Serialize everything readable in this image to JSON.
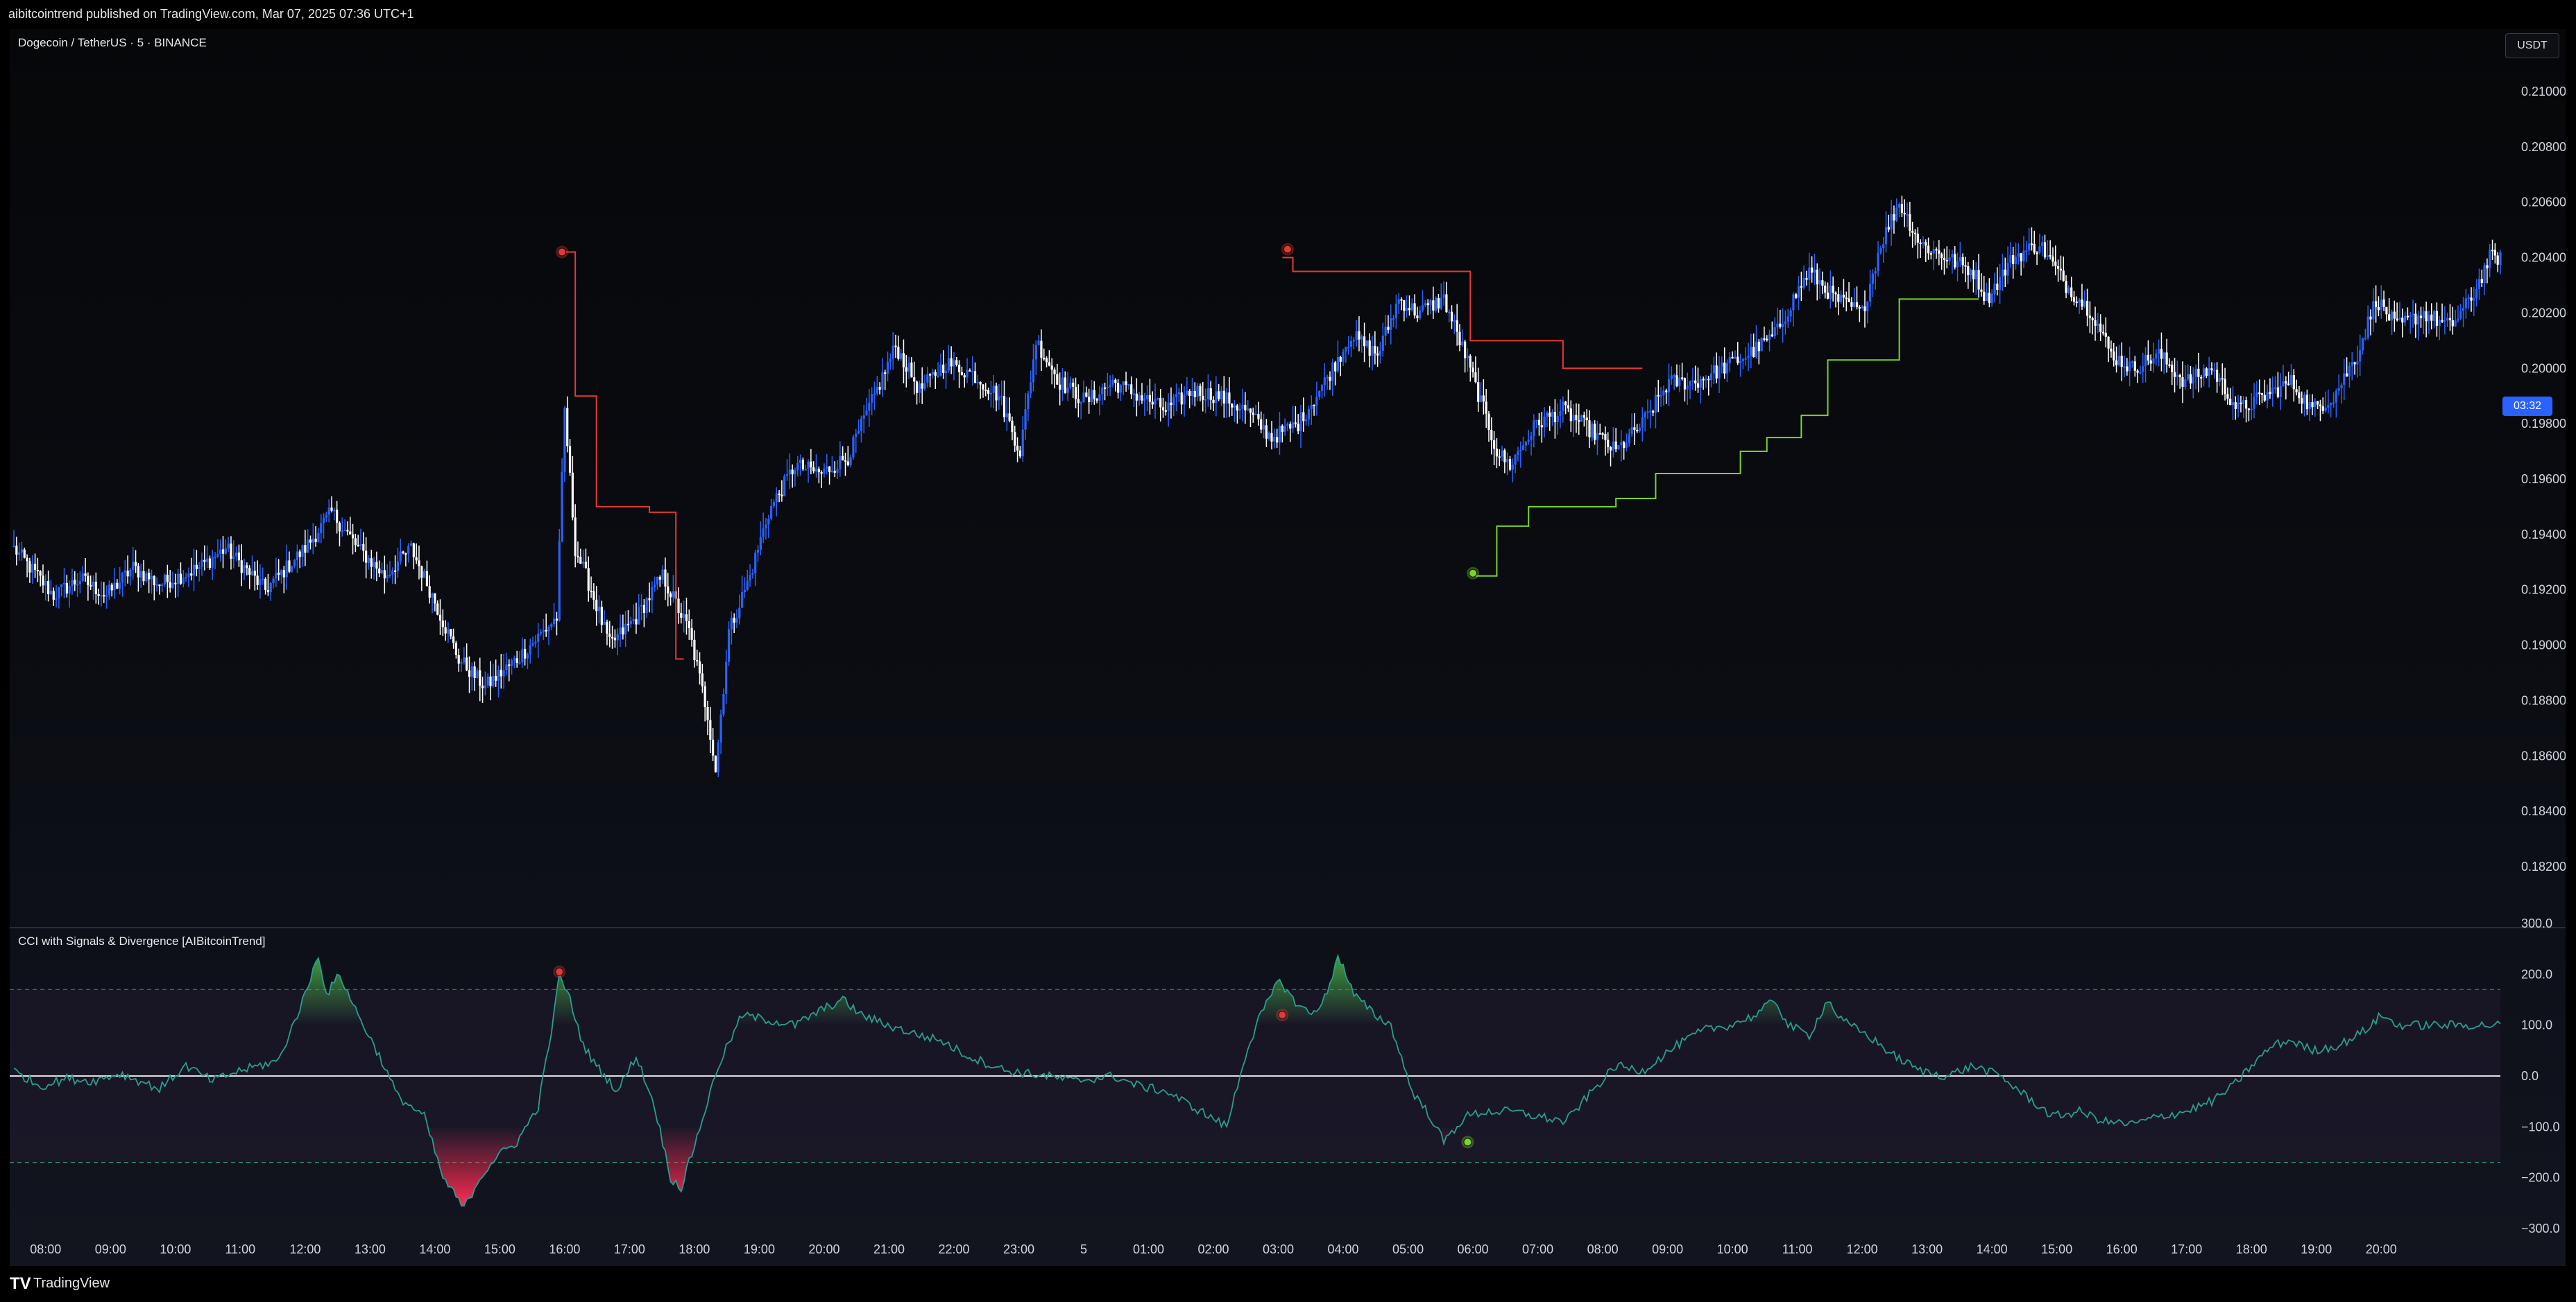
{
  "header": {
    "published_text": "aibitcointrend published on TradingView.com, Mar 07, 2025 07:36 UTC+1"
  },
  "chart": {
    "symbol_title": "Dogecoin / TetherUS · 5 · BINANCE",
    "currency_badge": "USDT",
    "price_countdown": "03:32"
  },
  "indicator": {
    "title": "CCI with Signals & Divergence [AIBitcoinTrend]"
  },
  "footer": {
    "brand": "TradingView",
    "logo": "TV"
  },
  "colors": {
    "up_candle": "#2962ff",
    "down_candle": "#ffffff",
    "bear_trail": "#e53935",
    "bull_trail": "#7cd322",
    "cci_line": "#2a9d8f",
    "cci_pos_fill": "#43a047",
    "cci_neg_fill": "#ff2d55"
  },
  "chart_data": [
    {
      "type": "candlestick",
      "title": "Dogecoin / TetherUS · 5 · BINANCE",
      "y_ticks": [
        "0.21000",
        "0.20800",
        "0.20600",
        "0.20400",
        "0.20200",
        "0.20000",
        "0.19800",
        "0.19600",
        "0.19400",
        "0.19200",
        "0.19000",
        "0.18800",
        "0.18600",
        "0.18400",
        "0.18200"
      ],
      "ylim": [
        0.1812,
        0.211
      ],
      "price_anchors": [
        [
          0,
          0.1935
        ],
        [
          15,
          0.1918
        ],
        [
          25,
          0.1924
        ],
        [
          35,
          0.1918
        ],
        [
          45,
          0.1928
        ],
        [
          55,
          0.1922
        ],
        [
          70,
          0.1928
        ],
        [
          80,
          0.1935
        ],
        [
          95,
          0.192
        ],
        [
          110,
          0.1935
        ],
        [
          120,
          0.1948
        ],
        [
          130,
          0.1935
        ],
        [
          140,
          0.1925
        ],
        [
          150,
          0.1935
        ],
        [
          158,
          0.1918
        ],
        [
          168,
          0.1895
        ],
        [
          178,
          0.1885
        ],
        [
          190,
          0.1895
        ],
        [
          200,
          0.1905
        ],
        [
          205,
          0.191
        ],
        [
          208,
          0.1985
        ],
        [
          212,
          0.1935
        ],
        [
          218,
          0.192
        ],
        [
          225,
          0.19
        ],
        [
          235,
          0.191
        ],
        [
          245,
          0.1925
        ],
        [
          255,
          0.1905
        ],
        [
          262,
          0.1875
        ],
        [
          265,
          0.1855
        ],
        [
          270,
          0.1905
        ],
        [
          278,
          0.1925
        ],
        [
          285,
          0.1948
        ],
        [
          295,
          0.1965
        ],
        [
          305,
          0.1962
        ],
        [
          315,
          0.1968
        ],
        [
          325,
          0.199
        ],
        [
          333,
          0.2008
        ],
        [
          342,
          0.1992
        ],
        [
          352,
          0.2002
        ],
        [
          362,
          0.1998
        ],
        [
          372,
          0.199
        ],
        [
          380,
          0.197
        ],
        [
          386,
          0.201
        ],
        [
          395,
          0.1995
        ],
        [
          405,
          0.1988
        ],
        [
          415,
          0.1995
        ],
        [
          425,
          0.199
        ],
        [
          435,
          0.1985
        ],
        [
          445,
          0.1992
        ],
        [
          455,
          0.199
        ],
        [
          465,
          0.1985
        ],
        [
          475,
          0.1975
        ],
        [
          485,
          0.198
        ],
        [
          495,
          0.1995
        ],
        [
          505,
          0.2012
        ],
        [
          515,
          0.2005
        ],
        [
          523,
          0.2025
        ],
        [
          530,
          0.202
        ],
        [
          540,
          0.2025
        ],
        [
          548,
          0.2005
        ],
        [
          555,
          0.1985
        ],
        [
          560,
          0.197
        ],
        [
          565,
          0.1965
        ],
        [
          575,
          0.198
        ],
        [
          585,
          0.1985
        ],
        [
          595,
          0.1978
        ],
        [
          605,
          0.197
        ],
        [
          615,
          0.198
        ],
        [
          625,
          0.1995
        ],
        [
          635,
          0.1995
        ],
        [
          645,
          0.2
        ],
        [
          655,
          0.2005
        ],
        [
          665,
          0.2012
        ],
        [
          672,
          0.2025
        ],
        [
          678,
          0.2035
        ],
        [
          688,
          0.2025
        ],
        [
          698,
          0.202
        ],
        [
          705,
          0.2045
        ],
        [
          712,
          0.206
        ],
        [
          720,
          0.2045
        ],
        [
          730,
          0.204
        ],
        [
          740,
          0.2035
        ],
        [
          745,
          0.2025
        ],
        [
          755,
          0.204
        ],
        [
          765,
          0.2045
        ],
        [
          775,
          0.203
        ],
        [
          785,
          0.202
        ],
        [
          792,
          0.2005
        ],
        [
          800,
          0.2
        ],
        [
          810,
          0.2005
        ],
        [
          820,
          0.1995
        ],
        [
          830,
          0.2
        ],
        [
          840,
          0.1985
        ],
        [
          850,
          0.199
        ],
        [
          860,
          0.1995
        ],
        [
          868,
          0.1985
        ],
        [
          876,
          0.199
        ],
        [
          885,
          0.2005
        ],
        [
          892,
          0.2025
        ],
        [
          900,
          0.2015
        ],
        [
          910,
          0.202
        ],
        [
          920,
          0.2015
        ],
        [
          928,
          0.2025
        ],
        [
          935,
          0.204
        ]
      ]
    },
    {
      "type": "line",
      "title": "CCI with Signals & Divergence [AIBitcoinTrend]",
      "y_ticks": [
        "300.0",
        "200.0",
        "100.0",
        "0.0",
        "−100.0",
        "−200.0",
        "−300.0"
      ],
      "ylim": [
        -300,
        300
      ],
      "bands": [
        -170,
        170
      ],
      "cci_anchors": [
        [
          0,
          10
        ],
        [
          10,
          -20
        ],
        [
          20,
          -5
        ],
        [
          30,
          -10
        ],
        [
          40,
          5
        ],
        [
          55,
          -25
        ],
        [
          65,
          20
        ],
        [
          75,
          -10
        ],
        [
          85,
          10
        ],
        [
          100,
          30
        ],
        [
          110,
          160
        ],
        [
          115,
          240
        ],
        [
          118,
          160
        ],
        [
          123,
          200
        ],
        [
          130,
          120
        ],
        [
          138,
          40
        ],
        [
          145,
          -40
        ],
        [
          155,
          -80
        ],
        [
          162,
          -200
        ],
        [
          170,
          -260
        ],
        [
          176,
          -200
        ],
        [
          182,
          -160
        ],
        [
          190,
          -130
        ],
        [
          198,
          -60
        ],
        [
          204,
          120
        ],
        [
          206,
          200
        ],
        [
          210,
          150
        ],
        [
          215,
          60
        ],
        [
          220,
          20
        ],
        [
          228,
          -30
        ],
        [
          235,
          40
        ],
        [
          242,
          -60
        ],
        [
          248,
          -200
        ],
        [
          252,
          -220
        ],
        [
          258,
          -120
        ],
        [
          266,
          20
        ],
        [
          275,
          120
        ],
        [
          285,
          110
        ],
        [
          295,
          100
        ],
        [
          305,
          130
        ],
        [
          313,
          150
        ],
        [
          320,
          120
        ],
        [
          330,
          100
        ],
        [
          342,
          80
        ],
        [
          350,
          70
        ],
        [
          360,
          40
        ],
        [
          375,
          10
        ],
        [
          390,
          0
        ],
        [
          400,
          -10
        ],
        [
          415,
          0
        ],
        [
          425,
          -20
        ],
        [
          435,
          -30
        ],
        [
          445,
          -60
        ],
        [
          455,
          -90
        ],
        [
          458,
          -100
        ],
        [
          465,
          40
        ],
        [
          470,
          110
        ],
        [
          478,
          190
        ],
        [
          483,
          150
        ],
        [
          490,
          120
        ],
        [
          496,
          160
        ],
        [
          500,
          240
        ],
        [
          506,
          160
        ],
        [
          514,
          120
        ],
        [
          520,
          100
        ],
        [
          528,
          -30
        ],
        [
          535,
          -80
        ],
        [
          540,
          -130
        ],
        [
          548,
          -80
        ],
        [
          556,
          -70
        ],
        [
          566,
          -70
        ],
        [
          576,
          -80
        ],
        [
          586,
          -90
        ],
        [
          596,
          -30
        ],
        [
          605,
          20
        ],
        [
          615,
          10
        ],
        [
          628,
          60
        ],
        [
          638,
          90
        ],
        [
          648,
          100
        ],
        [
          658,
          120
        ],
        [
          665,
          150
        ],
        [
          670,
          100
        ],
        [
          678,
          80
        ],
        [
          685,
          150
        ],
        [
          690,
          110
        ],
        [
          700,
          80
        ],
        [
          710,
          40
        ],
        [
          720,
          10
        ],
        [
          730,
          0
        ],
        [
          740,
          20
        ],
        [
          750,
          0
        ],
        [
          760,
          -40
        ],
        [
          770,
          -80
        ],
        [
          780,
          -70
        ],
        [
          790,
          -90
        ],
        [
          800,
          -95
        ],
        [
          810,
          -80
        ],
        [
          820,
          -70
        ],
        [
          830,
          -50
        ],
        [
          838,
          -20
        ],
        [
          845,
          20
        ],
        [
          853,
          60
        ],
        [
          860,
          70
        ],
        [
          868,
          50
        ],
        [
          878,
          60
        ],
        [
          888,
          90
        ],
        [
          894,
          120
        ],
        [
          900,
          100
        ]
      ],
      "signal_markers": [
        "bearish @ 15:30 (CCI ~200)",
        "bearish @ 02:35 (CCI ~120)",
        "bullish @ 05:25 (CCI ~-130)"
      ]
    }
  ],
  "x_axis_labels": [
    "08:00",
    "09:00",
    "10:00",
    "11:00",
    "12:00",
    "13:00",
    "14:00",
    "15:00",
    "16:00",
    "17:00",
    "18:00",
    "19:00",
    "20:00",
    "21:00",
    "22:00",
    "23:00",
    "5",
    "01:00",
    "02:00",
    "03:00",
    "04:00",
    "05:00",
    "06:00",
    "07:00",
    "08:00",
    "09:00",
    "10:00",
    "11:00",
    "12:00",
    "13:00",
    "14:00",
    "15:00",
    "16:00",
    "17:00",
    "18:00",
    "19:00",
    "20:00"
  ]
}
